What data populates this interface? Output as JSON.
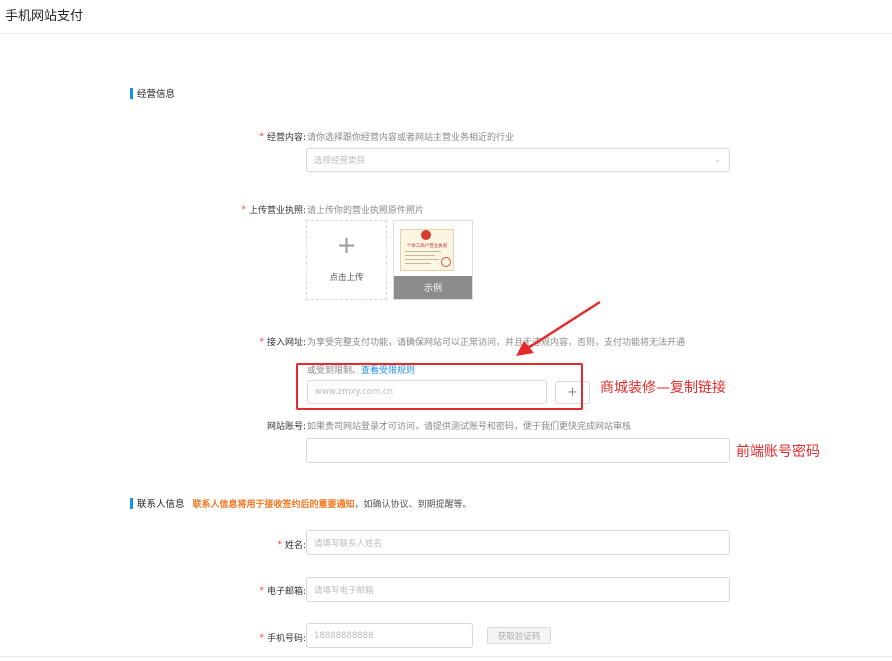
{
  "page": {
    "title": "手机网站支付"
  },
  "business": {
    "section_title": "经营信息",
    "content": {
      "required_mark": "*",
      "label": "经营内容:",
      "hint": "请你选择跟你经营内容或者网站主营业务相近的行业",
      "placeholder": "选择经营类目"
    },
    "license": {
      "required_mark": "*",
      "label": "上传营业执照:",
      "hint": "请上传你的营业执照原件照片",
      "upload_label": "点击上传",
      "example_label": "示例",
      "example_image_text": "个体工商户营业执照"
    },
    "website": {
      "required_mark": "*",
      "label": "接入网址:",
      "hint_line1": "为享受完整支付功能，请确保网站可以正常访问，并且无违规内容，否则，支付功能将无法开通",
      "hint_line2": "或受到限制。",
      "rules_link": "查看受限规则",
      "placeholder": "www.zmxy.com.cn",
      "add_symbol": "+"
    },
    "account": {
      "label": "网站账号:",
      "hint": "如果贵司网站登录才可访问，请提供测试账号和密码，便于我们更快完成网站审核",
      "value": ""
    }
  },
  "annotations": {
    "copy_link": "商城装修—复制链接",
    "account_password": "前端账号密码"
  },
  "contact": {
    "section_title": "联系人信息",
    "notice_highlight": "联系人信息将用于接收签约后的重要通知",
    "notice_rest": "，如确认协议、到期提醒等。",
    "name": {
      "required_mark": "*",
      "label": "姓名:",
      "placeholder": "请填写联系人姓名"
    },
    "email": {
      "required_mark": "*",
      "label": "电子邮箱:",
      "placeholder": "请填写电子邮箱"
    },
    "phone": {
      "required_mark": "*",
      "label": "手机号码:",
      "placeholder": "18888888888",
      "code_button": "获取验证码"
    }
  },
  "colors": {
    "accent": "#1a8ff0",
    "required": "#f04134",
    "annotation": "#e42a2a",
    "warning": "#f5751e"
  }
}
